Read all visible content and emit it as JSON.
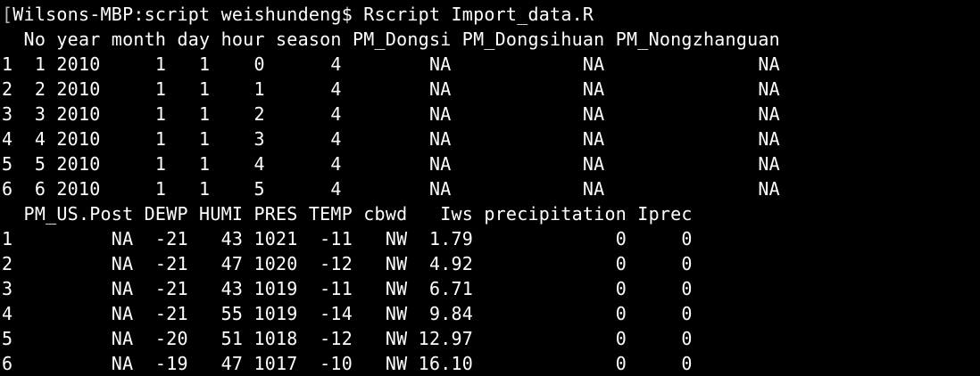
{
  "terminal": {
    "prompt": "Wilsons-MBP:script weishundeng$",
    "command": "Rscript Import_data.R",
    "output_lines": [
      "  No year month day hour season PM_Dongsi PM_Dongsihuan PM_Nongzhanguan",
      "1  1 2010     1   1    0      4        NA            NA              NA",
      "2  2 2010     1   1    1      4        NA            NA              NA",
      "3  3 2010     1   1    2      4        NA            NA              NA",
      "4  4 2010     1   1    3      4        NA            NA              NA",
      "5  5 2010     1   1    4      4        NA            NA              NA",
      "6  6 2010     1   1    5      4        NA            NA              NA",
      "  PM_US.Post DEWP HUMI PRES TEMP cbwd   Iws precipitation Iprec",
      "1         NA  -21   43 1021  -11   NW  1.79             0     0",
      "2         NA  -21   47 1020  -12   NW  4.92             0     0",
      "3         NA  -21   43 1019  -11   NW  6.71             0     0",
      "4         NA  -21   55 1019  -14   NW  9.84             0     0",
      "5         NA  -20   51 1018  -12   NW 12.97             0     0",
      "6         NA  -19   47 1017  -10   NW 16.10             0     0"
    ]
  }
}
